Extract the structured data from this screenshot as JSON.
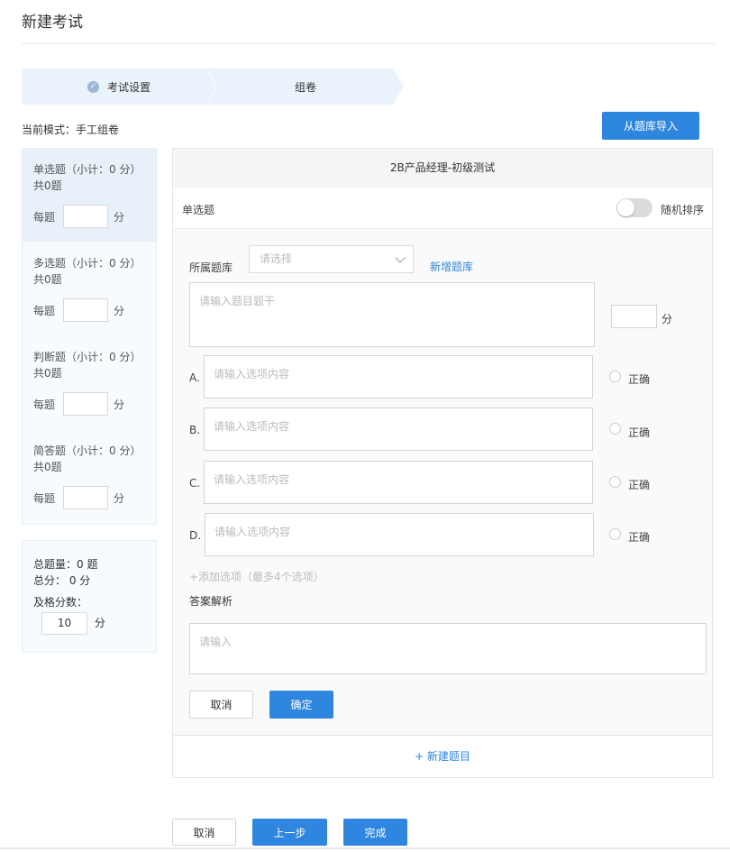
{
  "page": {
    "title": "新建考试"
  },
  "steps": [
    {
      "label": "考试设置",
      "done": true
    },
    {
      "label": "组卷",
      "done": false
    }
  ],
  "mode": {
    "text": "当前模式：手工组卷"
  },
  "import_button": "从题库导入",
  "question_types": [
    {
      "title": "单选题（小计：0 分）",
      "count": "共0题",
      "per_label": "每题",
      "unit": "分",
      "value": ""
    },
    {
      "title": "多选题（小计：0 分）",
      "count": "共0题",
      "per_label": "每题",
      "unit": "分",
      "value": ""
    },
    {
      "title": "判断题（小计：0 分）",
      "count": "共0题",
      "per_label": "每题",
      "unit": "分",
      "value": ""
    },
    {
      "title": "简答题（小计：0 分）",
      "count": "共0题",
      "per_label": "每题",
      "unit": "分",
      "value": ""
    }
  ],
  "summary": {
    "total_questions": "总题量：0 题",
    "total_score": "总分： 0 分",
    "pass_label": "及格分数：",
    "pass_value": "10",
    "pass_unit": "分"
  },
  "exam": {
    "title": "2B产品经理-初级测试"
  },
  "editor": {
    "question_type": "单选题",
    "random_order_label": "随机排序",
    "random_order_on": false,
    "bank_label": "所属题库",
    "bank_placeholder": "请选择",
    "new_bank_link": "新增题库",
    "stem_placeholder": "请输入题目题干",
    "score_unit": "分",
    "options": [
      {
        "letter": "A.",
        "placeholder": "请输入选项内容",
        "correct_label": "正确"
      },
      {
        "letter": "B.",
        "placeholder": "请输入选项内容",
        "correct_label": "正确"
      },
      {
        "letter": "C.",
        "placeholder": "请输入选项内容",
        "correct_label": "正确"
      },
      {
        "letter": "D.",
        "placeholder": "请输入选项内容",
        "correct_label": "正确"
      }
    ],
    "add_option": "+添加选项（最多4个选项）",
    "analysis_label": "答案解析",
    "analysis_placeholder": "请输入",
    "cancel": "取消",
    "confirm": "确定"
  },
  "new_question": "+ 新建题目",
  "footer": {
    "cancel": "取消",
    "prev": "上一步",
    "finish": "完成"
  },
  "colors": {
    "primary": "#2f86de",
    "step_bg": "#eaf2fb",
    "sidebar_bg": "#f7fbfe"
  }
}
